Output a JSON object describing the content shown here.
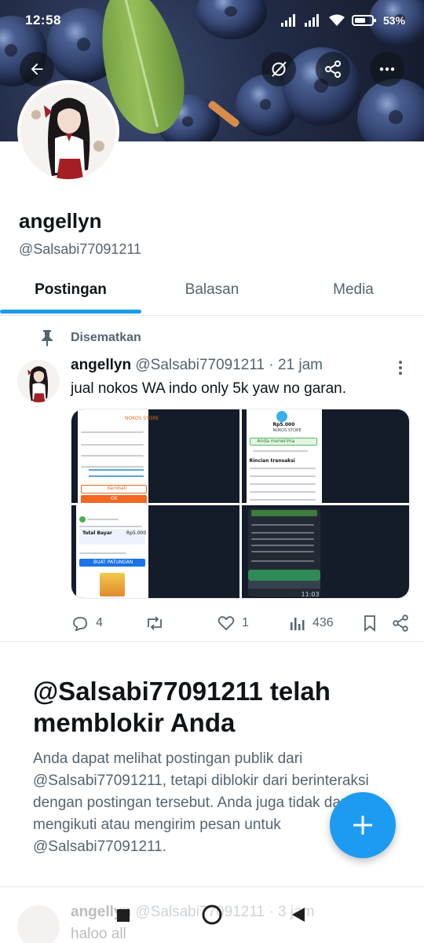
{
  "status_bar": {
    "time": "12:58",
    "battery": "53"
  },
  "header": {
    "back_icon": "arrow-left-icon",
    "buttons": [
      "mute-icon",
      "share-icon",
      "more-icon"
    ]
  },
  "profile": {
    "name": "angellyn",
    "handle": "@Salsabi77091211"
  },
  "tabs": [
    {
      "label": "Postingan",
      "active": true
    },
    {
      "label": "Balasan",
      "active": false
    },
    {
      "label": "Media",
      "active": false
    }
  ],
  "pinned_post": {
    "pinned_label": "Disematkan",
    "author_name": "angellyn",
    "author_handle": "@Salsabi77091211",
    "time": "21 jam",
    "separator": "·",
    "text": "jual nokos WA indo only 5k yaw no garan.",
    "stats": {
      "replies": "4",
      "retweets": "",
      "likes": "1",
      "views": "436"
    }
  },
  "blocked": {
    "title": "@Salsabi77091211 telah memblokir Anda",
    "body": "Anda dapat melihat postingan publik dari @Salsabi77091211, tetapi diblokir dari berinteraksi dengan postingan tersebut. Anda juga tidak dapat mengikuti atau mengirim pesan untuk @Salsabi77091211."
  },
  "next_post": {
    "author_name": "angellyn",
    "author_handle": "@Salsabi77091211",
    "time": "3 jam",
    "text": "haloo all"
  },
  "colors": {
    "accent": "#1d9bf0",
    "text_primary": "#0f1419",
    "text_secondary": "#536471"
  },
  "screenshots_text": {
    "ss1_store": "NOKOS STORE",
    "ss1_btn1": "Kembali",
    "ss1_btn2": "OK",
    "ss2_price": "Rp5.000",
    "ss2_store": "NOKOS STORE",
    "ss2_status": "Anda menerima",
    "ss2_details": "Rincian transaksi",
    "ss3_total": "Total Bayar",
    "ss3_amount": "Rp5.000",
    "ss3_cta": "BUAT PATUNGAN",
    "ss4_time": "11:03"
  }
}
